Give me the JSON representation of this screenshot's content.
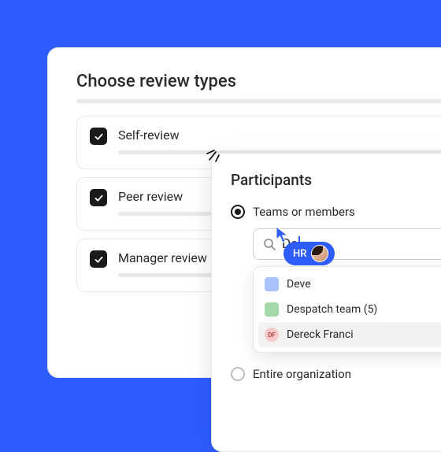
{
  "main": {
    "title": "Choose review types",
    "options": [
      {
        "label": "Self-review",
        "checked": true
      },
      {
        "label": "Peer review",
        "checked": true
      },
      {
        "label": "Manager review",
        "checked": true
      }
    ]
  },
  "participants": {
    "title": "Participants",
    "radios": {
      "teams": {
        "label": "Teams or members",
        "selected": true
      },
      "org": {
        "label": "Entire organization",
        "selected": false
      }
    },
    "search_query": "De",
    "suggestions": [
      {
        "label": "Deve",
        "color": "#A9C3FF",
        "type": "swatch"
      },
      {
        "label": "Despatch team (5)",
        "color": "#A3D9A8",
        "type": "swatch"
      },
      {
        "label": "Dereck Franci",
        "color": "#F7C9C9",
        "initials": "DF",
        "type": "avatar",
        "hover": true
      }
    ]
  },
  "cursor": {
    "user_label": "HR"
  }
}
